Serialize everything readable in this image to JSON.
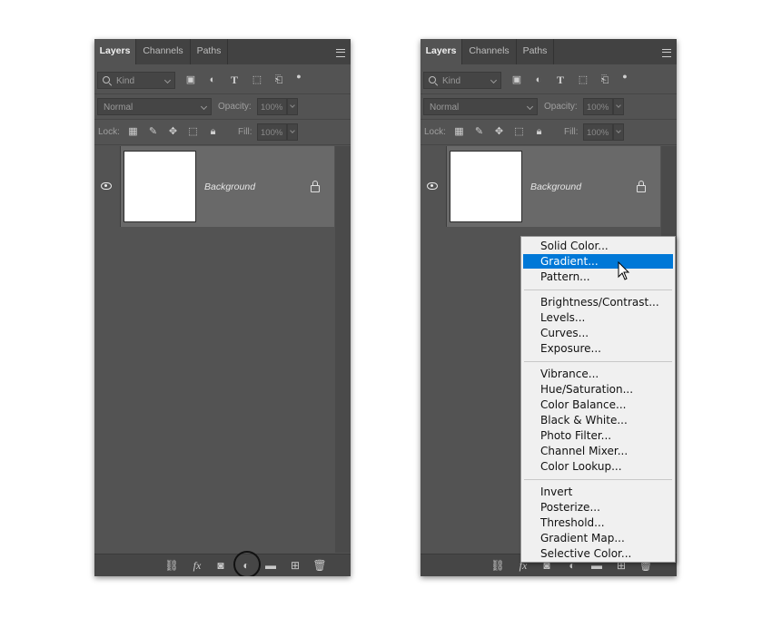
{
  "panels": {
    "tabs": [
      "Layers",
      "Channels",
      "Paths"
    ],
    "filter_kind": "Kind",
    "blend_mode": "Normal",
    "opacity_label": "Opacity:",
    "opacity_value": "100%",
    "lock_label": "Lock:",
    "fill_label": "Fill:",
    "fill_value": "100%",
    "layer_name": "Background",
    "filter_icons": [
      "image-filter-icon",
      "adjustment-filter-icon",
      "type-filter-icon",
      "shape-filter-icon",
      "smartobject-filter-icon"
    ],
    "lock_icons": [
      "lock-transparent-icon",
      "lock-image-icon",
      "lock-position-icon",
      "lock-artboard-icon",
      "lock-all-icon"
    ],
    "bottom_icons": [
      "link-layers-icon",
      "fx-icon",
      "layer-mask-icon",
      "adjustment-layer-icon",
      "group-folder-icon",
      "new-layer-icon",
      "delete-icon"
    ],
    "fx_text": "fx"
  },
  "adjustment_menu": {
    "selected": "Gradient...",
    "groups": [
      [
        "Solid Color...",
        "Gradient...",
        "Pattern..."
      ],
      [
        "Brightness/Contrast...",
        "Levels...",
        "Curves...",
        "Exposure..."
      ],
      [
        "Vibrance...",
        "Hue/Saturation...",
        "Color Balance...",
        "Black & White...",
        "Photo Filter...",
        "Channel Mixer...",
        "Color Lookup..."
      ],
      [
        "Invert",
        "Posterize...",
        "Threshold...",
        "Gradient Map...",
        "Selective Color..."
      ]
    ]
  },
  "colors": {
    "panel_bg": "#535353",
    "layer_selected_bg": "#696969",
    "menu_highlight": "#0078d7"
  }
}
